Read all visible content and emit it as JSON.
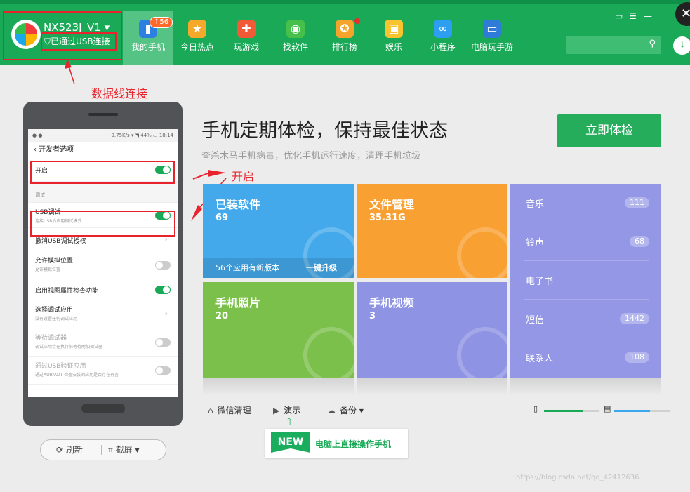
{
  "device": {
    "name": "NX523J_V1",
    "dropdown_icon": "caret-down-icon",
    "usb_status": "已通过USB连接"
  },
  "nav": [
    {
      "label": "我的手机",
      "icon": "phone-icon",
      "color": "#2d7fe0",
      "badge": "56",
      "active": true
    },
    {
      "label": "今日热点",
      "icon": "star-icon",
      "color": "#f4a92a"
    },
    {
      "label": "玩游戏",
      "icon": "gamepad-icon",
      "color": "#f05a36"
    },
    {
      "label": "找软件",
      "icon": "android-icon",
      "color": "#46c04a"
    },
    {
      "label": "排行榜",
      "icon": "medal-icon",
      "color": "#f4a42a",
      "dot": true
    },
    {
      "label": "娱乐",
      "icon": "gift-icon",
      "color": "#f7c32e"
    },
    {
      "label": "小程序",
      "icon": "miniapp-icon",
      "color": "#2d9ef0"
    },
    {
      "label": "电脑玩手游",
      "icon": "pc-game-icon",
      "color": "#2f7cd8"
    }
  ],
  "annotations": {
    "cable": "数据线连接",
    "enable": "开启"
  },
  "phone_screen": {
    "status_left": "● ●",
    "status_right": "9.75K/s ▾ ◥ 44% ▭ 18:14",
    "back_title": "‹ 开发者选项",
    "rows": [
      {
        "title": "开启",
        "toggle": "on"
      },
      {
        "title": "调试",
        "section": true
      },
      {
        "title": "USB调试",
        "sub": "连接USB后启用调试模式",
        "toggle": "on"
      },
      {
        "title": "撤消USB调试授权",
        "chevron": "›"
      },
      {
        "title": "允许模拟位置",
        "sub": "允许模拟位置",
        "toggle": "off"
      },
      {
        "title": "启用视图属性检查功能",
        "toggle": "on"
      },
      {
        "title": "选择调试应用",
        "sub": "没有设置任何调试应用",
        "chevron": "›"
      },
      {
        "title": "等待调试器",
        "sub": "调试应用会在执行前等待附加调试器",
        "toggle": "off",
        "disabled": true
      },
      {
        "title": "通过USB验证应用",
        "sub": "通过ADB/ADT 检查安装的应用是否存在有害",
        "toggle": "off",
        "disabled": true
      }
    ]
  },
  "phone_buttons": {
    "refresh": "刷新",
    "refresh_icon": "refresh-icon",
    "screenshot": "截屏",
    "screenshot_icon": "crop-icon",
    "screenshot_caret": "▾"
  },
  "main": {
    "headline": "手机定期体检，保持最佳状态",
    "subline": "查杀木马手机病毒，优化手机运行速度，清理手机垃圾",
    "check_button": "立即体检"
  },
  "tiles": {
    "apps": {
      "title": "已装软件",
      "value": "69",
      "update_text": "56个应用有新版本",
      "upgrade": "一键升级",
      "color": "#44a9ea"
    },
    "files": {
      "title": "文件管理",
      "value": "35.31G",
      "color": "#f9a032"
    },
    "photos": {
      "title": "手机照片",
      "value": "20",
      "color": "#7cc04c"
    },
    "videos": {
      "title": "手机视频",
      "value": "3",
      "color": "#8e93e3"
    }
  },
  "media_list": {
    "color": "#9397e5",
    "items": [
      {
        "label": "音乐",
        "count": "111"
      },
      {
        "label": "铃声",
        "count": "68"
      },
      {
        "label": "电子书",
        "count": ""
      },
      {
        "label": "短信",
        "count": "1442"
      },
      {
        "label": "联系人",
        "count": "108"
      }
    ]
  },
  "toolbar": {
    "wechat_clean": "微信清理",
    "demo": "演示",
    "backup": "备份",
    "backup_caret": "▾"
  },
  "storage": {
    "phone_used": 0.7,
    "sd_used": 0.65
  },
  "new_feature": {
    "badge": "NEW",
    "text": "电脑上直接操作手机"
  },
  "watermark": "https://blog.csdn.net/qq_42412636"
}
